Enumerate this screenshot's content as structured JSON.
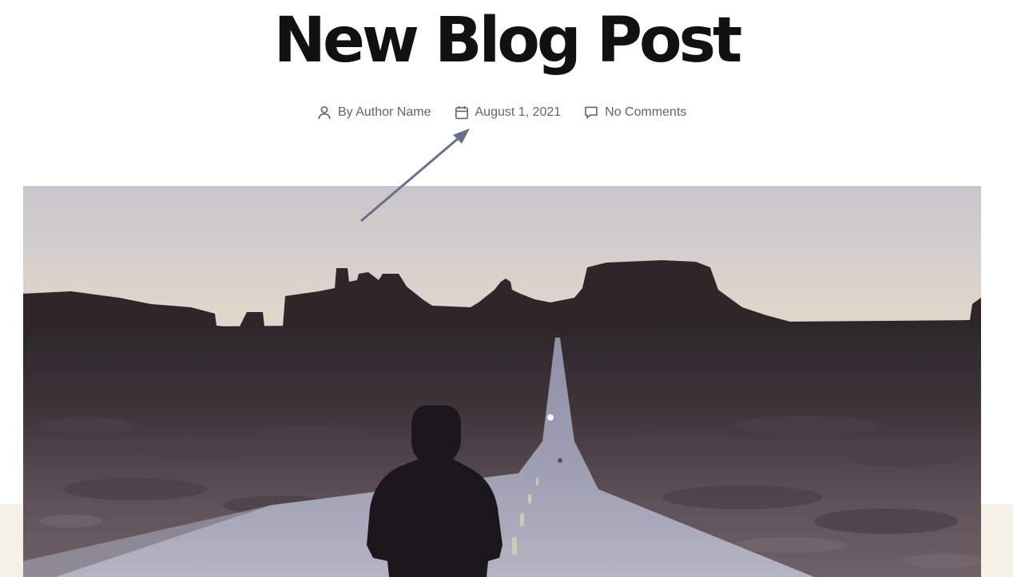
{
  "post": {
    "title": "New Blog Post",
    "author": "By Author Name",
    "date": "August 1, 2021",
    "comments": "No Comments"
  },
  "icons": {
    "author": "person-icon",
    "date": "calendar-icon",
    "comments": "comment-bubble-icon"
  },
  "colors": {
    "title": "#111111",
    "meta_text": "#5d6470",
    "annotation_arrow": "#6b6f88",
    "page_background": "#ffffff",
    "lower_band": "#f6f1e7"
  },
  "featured_image": {
    "alt": "Person in a hooded jacket standing on a long straight desert road leading toward distant mesas at dusk"
  }
}
